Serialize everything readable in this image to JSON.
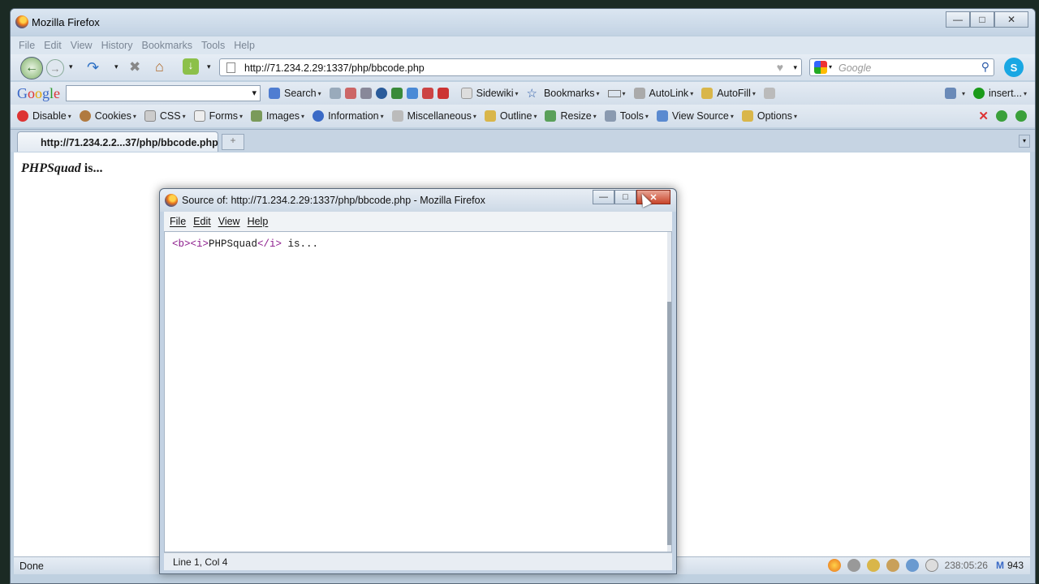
{
  "window": {
    "title": "Mozilla Firefox"
  },
  "menubar": [
    "File",
    "Edit",
    "View",
    "History",
    "Bookmarks",
    "Tools",
    "Help"
  ],
  "navbar": {
    "url": "http://71.234.2.29:1337/php/bbcode.php",
    "search_placeholder": "Google"
  },
  "googlebar": {
    "logo": "Google",
    "items": [
      "Search",
      "Sidewiki",
      "Bookmarks",
      "AutoLink",
      "AutoFill",
      "insert..."
    ]
  },
  "devbar": {
    "items": [
      "Disable",
      "Cookies",
      "CSS",
      "Forms",
      "Images",
      "Information",
      "Miscellaneous",
      "Outline",
      "Resize",
      "Tools",
      "View Source",
      "Options"
    ]
  },
  "tabs": [
    {
      "label": "http://71.234.2.2...37/php/bbcode.php"
    }
  ],
  "page": {
    "strong_italic": "PHPSquad",
    "rest": " is..."
  },
  "statusbar": {
    "text": "Done",
    "time": "238:05:26",
    "mail_count": "943"
  },
  "source_window": {
    "title": "Source of: http://71.234.2.29:1337/php/bbcode.php - Mozilla Firefox",
    "menu": [
      "File",
      "Edit",
      "View",
      "Help"
    ],
    "code": {
      "tag1": "<b><i>",
      "text": "PHPSquad",
      "tag2": "</i>",
      "rest": " is..."
    },
    "status": "Line 1, Col 4"
  },
  "colors": {
    "accent_close": "#c8452a",
    "tag_color": "#8b1a8b"
  }
}
